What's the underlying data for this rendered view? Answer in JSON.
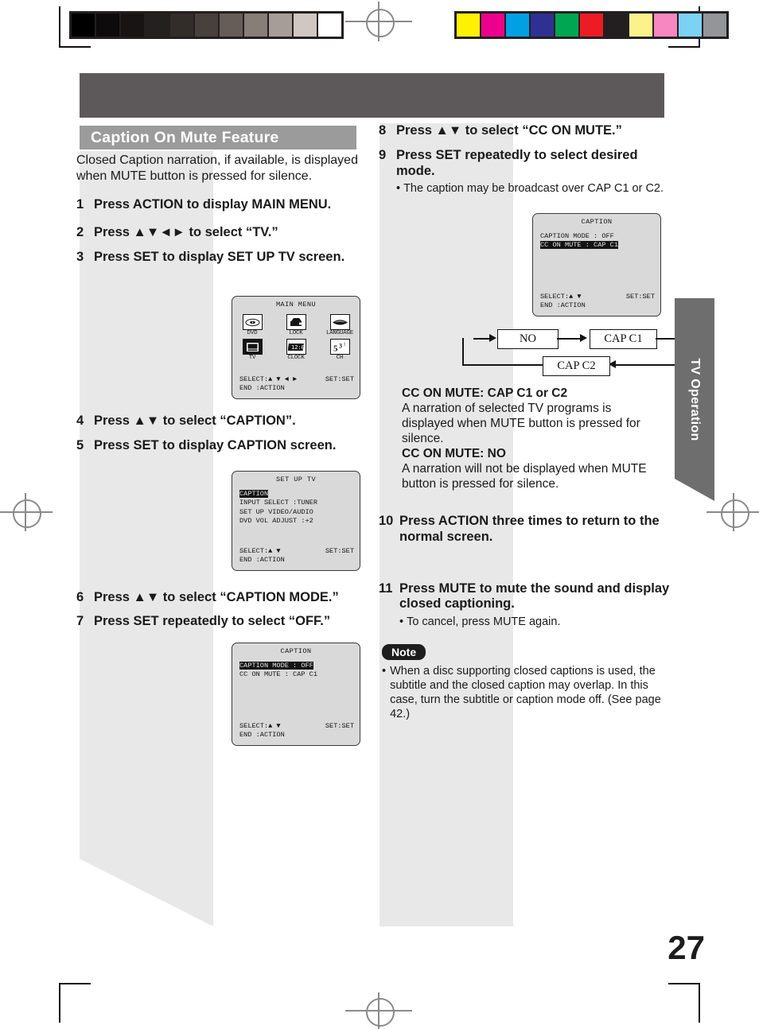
{
  "document": {
    "page_number": "27",
    "side_tab_label": "TV Operation"
  },
  "color_bars": {
    "grayscale_label": "grayscale-calibration-bar",
    "grayscale": [
      "#000000",
      "#0d0b0b",
      "#181414",
      "#23201e",
      "#332d2a",
      "#47403c",
      "#665d59",
      "#877e79",
      "#a79d98",
      "#d0c7c2",
      "#ffffff"
    ],
    "color_label": "color-calibration-bar",
    "colors": [
      "#fff200",
      "#ec008c",
      "#00a0e3",
      "#2e3192",
      "#00a651",
      "#ed1c24",
      "#231f20",
      "#fbf28c",
      "#f687c0",
      "#7bd2f2",
      "#939598"
    ]
  },
  "section": {
    "title": "Caption On Mute Feature",
    "intro": "Closed Caption narration, if available, is displayed when MUTE button is pressed for silence."
  },
  "left_steps": [
    {
      "num": "1",
      "text": "Press ACTION to display MAIN MENU."
    },
    {
      "num": "2",
      "text": "Press ▲▼◄► to select “TV.”"
    },
    {
      "num": "3",
      "text": "Press SET to display SET UP TV screen."
    },
    {
      "num": "4",
      "text": "Press ▲▼ to select “CAPTION”."
    },
    {
      "num": "5",
      "text": "Press SET to display CAPTION screen."
    },
    {
      "num": "6",
      "text": "Press ▲▼ to select “CAPTION MODE.”"
    },
    {
      "num": "7",
      "text": "Press SET repeatedly to select “OFF.”"
    }
  ],
  "right_steps": [
    {
      "num": "8",
      "text": "Press ▲▼ to select “CC ON MUTE.”"
    },
    {
      "num": "9",
      "text": "Press SET repeatedly to select desired  mode."
    },
    {
      "num": "10",
      "text": "Press ACTION three times to return to the normal screen."
    },
    {
      "num": "11",
      "text": "Press MUTE to mute the sound and display closed captioning."
    }
  ],
  "bullets": {
    "step9": "The caption may be broadcast over CAP C1 or C2.",
    "step11": "To cancel, press MUTE again.",
    "marker": "•"
  },
  "osd_main_menu": {
    "title": "MAIN MENU",
    "icons": [
      {
        "label": "DVD",
        "icon": "disc-icon",
        "selected": false
      },
      {
        "label": "LOCK",
        "icon": "lock-icon",
        "selected": false
      },
      {
        "label": "LANGUAGE",
        "icon": "language-icon",
        "selected": false
      },
      {
        "label": "TV",
        "icon": "tv-icon",
        "selected": true
      },
      {
        "label": "CLOCK",
        "icon": "clock-icon",
        "selected": false
      },
      {
        "label": "CH",
        "icon": "channel-icon",
        "selected": false
      }
    ],
    "footer_select": "SELECT:▲ ▼ ◄ ►",
    "footer_set": "SET:SET",
    "footer_end": "END    :ACTION"
  },
  "osd_set_up_tv": {
    "title": "SET UP TV",
    "rows": [
      {
        "text": "CAPTION",
        "highlight": true
      },
      {
        "text": "INPUT SELECT   :TUNER",
        "highlight": false
      },
      {
        "text": "SET UP VIDEO/AUDIO",
        "highlight": false
      },
      {
        "text": "DVD VOL ADJUST :+2",
        "highlight": false
      }
    ],
    "footer_select": "SELECT:▲ ▼",
    "footer_set": "SET:SET",
    "footer_end": "END   :ACTION"
  },
  "osd_caption_left": {
    "title": "CAPTION",
    "rows": [
      {
        "text": "CAPTION MODE : OFF",
        "highlight": true
      },
      {
        "text": "CC ON MUTE   : CAP C1",
        "highlight": false
      }
    ],
    "footer_select": "SELECT:▲ ▼",
    "footer_set": "SET:SET",
    "footer_end": "END   :ACTION"
  },
  "osd_caption_right": {
    "title": "CAPTION",
    "rows": [
      {
        "text": "CAPTION MODE : OFF",
        "highlight": false
      },
      {
        "text": "CC ON MUTE   : CAP C1",
        "highlight": true
      }
    ],
    "footer_select": "SELECT:▲ ▼",
    "footer_set": "SET:SET",
    "footer_end": "END   :ACTION"
  },
  "flow_diagram": {
    "boxes": [
      "NO",
      "CAP C1",
      "CAP C2"
    ],
    "description": "cycle: NO → CAP C1 → CAP C2 → NO"
  },
  "explanation": {
    "head1": "CC ON MUTE: CAP C1 or C2",
    "body1": "A narration of selected TV programs is displayed when MUTE button is pressed for silence.",
    "head2": "CC ON MUTE: NO",
    "body2": "A narration will not be displayed when MUTE button is pressed for silence."
  },
  "note": {
    "badge": "Note",
    "text": "When a disc supporting closed captions is used, the subtitle and the closed caption may overlap. In this case, turn the subtitle or caption mode off. (See page 42.)"
  }
}
